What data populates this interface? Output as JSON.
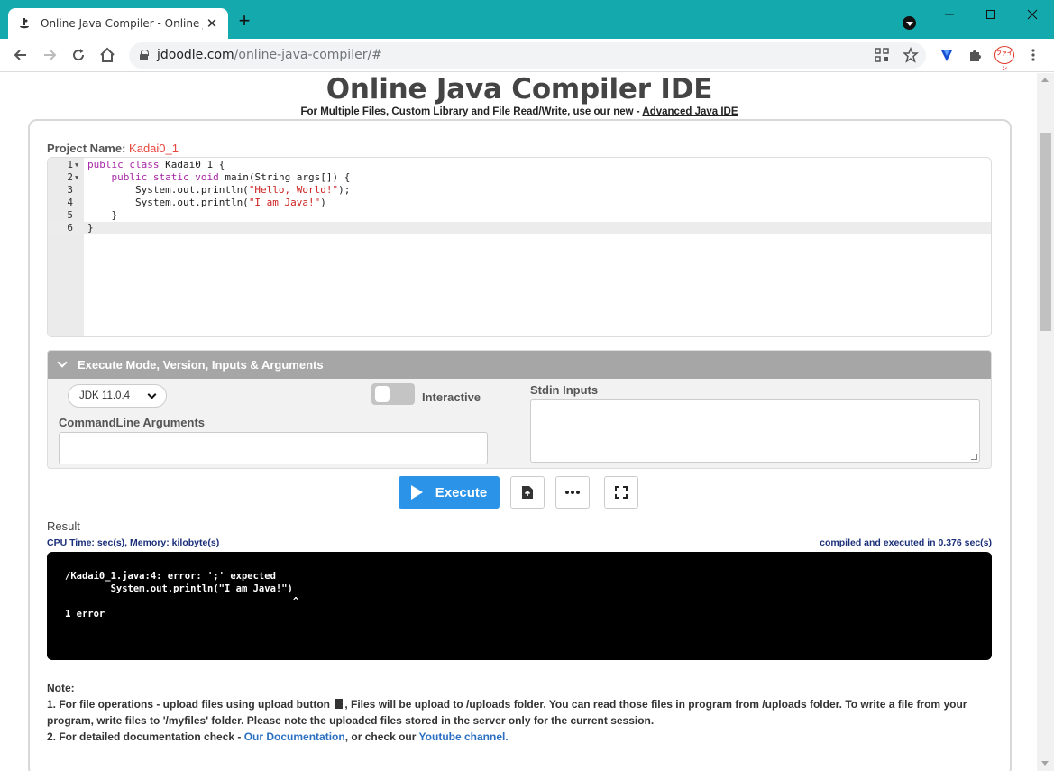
{
  "browser": {
    "tab_title": "Online Java Compiler - Online Ja",
    "tab_close": "✕",
    "new_tab": "+",
    "url_host": "jdoodle.com",
    "url_path": "/online-java-compiler/#",
    "extension_badge": "ファイン"
  },
  "header": {
    "title": "Online Java Compiler IDE",
    "subtitle_prefix": "For Multiple Files, Custom Library and File Read/Write, use our new - ",
    "subtitle_link": "Advanced Java IDE"
  },
  "project": {
    "label": "Project Name: ",
    "name": "Kadai0_1"
  },
  "editor": {
    "lines": [
      {
        "num": "1",
        "code": "public class Kadai0_1 {"
      },
      {
        "num": "2",
        "code": "    public static void main(String args[]) {"
      },
      {
        "num": "3",
        "code": "        System.out.println(\"Hello, World!\");"
      },
      {
        "num": "4",
        "code": "        System.out.println(\"I am Java!\")"
      },
      {
        "num": "5",
        "code": "    }"
      },
      {
        "num": "6",
        "code": "}"
      }
    ]
  },
  "options": {
    "section_title": "Execute Mode, Version, Inputs & Arguments",
    "jdk_version": "JDK 11.0.4",
    "interactive_label": "Interactive",
    "cmd_label": "CommandLine Arguments",
    "stdin_label": "Stdin Inputs"
  },
  "actions": {
    "execute_label": "Execute"
  },
  "result": {
    "label": "Result",
    "cpu_line": "CPU Time: sec(s), Memory: kilobyte(s)",
    "compiled_line": "compiled and executed in 0.376 sec(s)",
    "output": "/Kadai0_1.java:4: error: ';' expected\n        System.out.println(\"I am Java!\")\n                                        ^\n1 error"
  },
  "notes": {
    "heading": "Note:",
    "line1_a": "1. For file operations - upload files using upload button ",
    "line1_b": ", Files will be upload to /uploads folder. You can read those files in program from /uploads folder. To write a file from your program, write files to '/myfiles' folder. Please note the uploaded files stored in the server only for the current session.",
    "line2_a": "2. For detailed documentation check - ",
    "line2_link1": "Our Documentation",
    "line2_b": ", or check our ",
    "line2_link2": "Youtube channel."
  },
  "colors": {
    "titlebar": "#14a9ad",
    "execute": "#2b93e8",
    "project_name": "#e8453c"
  }
}
